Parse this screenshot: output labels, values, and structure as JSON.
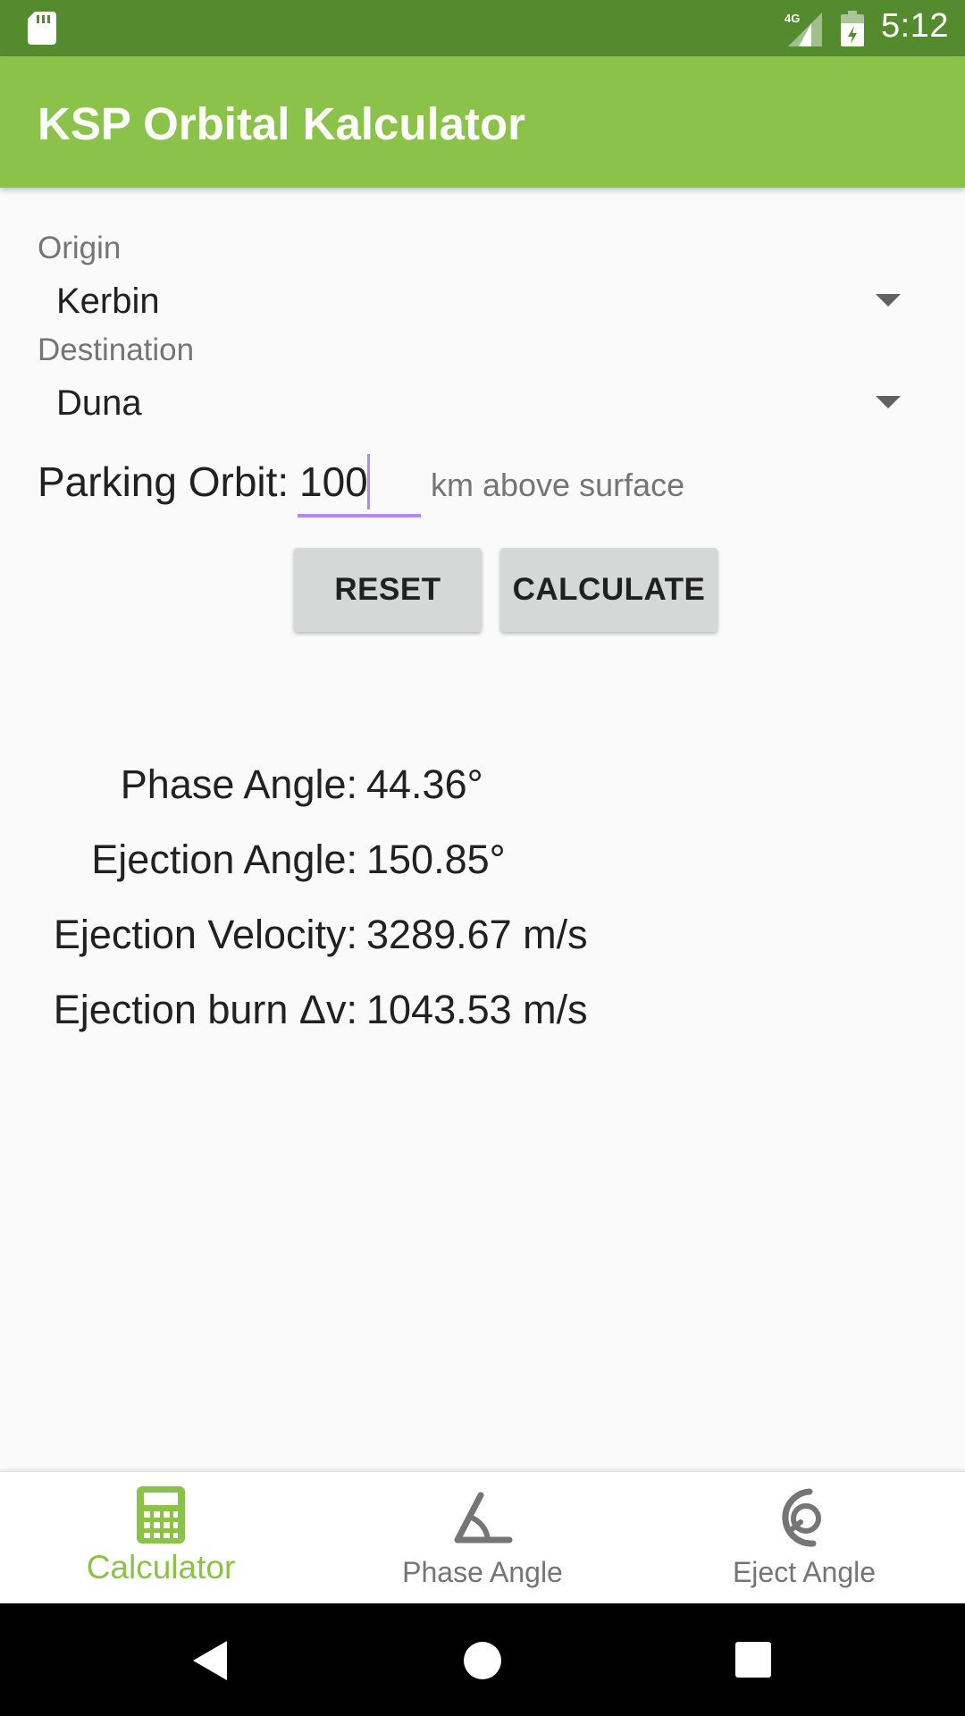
{
  "status_bar": {
    "time": "5:12",
    "network": "4G",
    "icons": [
      "sd-card-icon",
      "signal-icon",
      "battery-icon"
    ]
  },
  "app_bar": {
    "title": "KSP Orbital Kalculator"
  },
  "form": {
    "origin_label": "Origin",
    "origin_value": "Kerbin",
    "destination_label": "Destination",
    "destination_value": "Duna",
    "parking_label": "Parking Orbit:",
    "parking_value": "100",
    "parking_unit": "km above surface",
    "reset_label": "RESET",
    "calculate_label": "CALCULATE"
  },
  "results": {
    "phase_angle_label": "Phase Angle:",
    "phase_angle_value": "44.36°",
    "ejection_angle_label": "Ejection Angle:",
    "ejection_angle_value": "150.85°",
    "ejection_velocity_label": "Ejection Velocity:",
    "ejection_velocity_value": "3289.67 m/s",
    "ejection_burn_label": "Ejection burn Δv:",
    "ejection_burn_value": "1043.53 m/s"
  },
  "bottom_nav": {
    "items": [
      {
        "label": "Calculator",
        "icon": "calculator-icon",
        "active": true
      },
      {
        "label": "Phase Angle",
        "icon": "angle-icon",
        "active": false
      },
      {
        "label": "Eject Angle",
        "icon": "eject-angle-icon",
        "active": false
      }
    ]
  },
  "colors": {
    "primary": "#8bc34a",
    "primary_dark": "#558b2f",
    "accent": "#b388ff"
  }
}
